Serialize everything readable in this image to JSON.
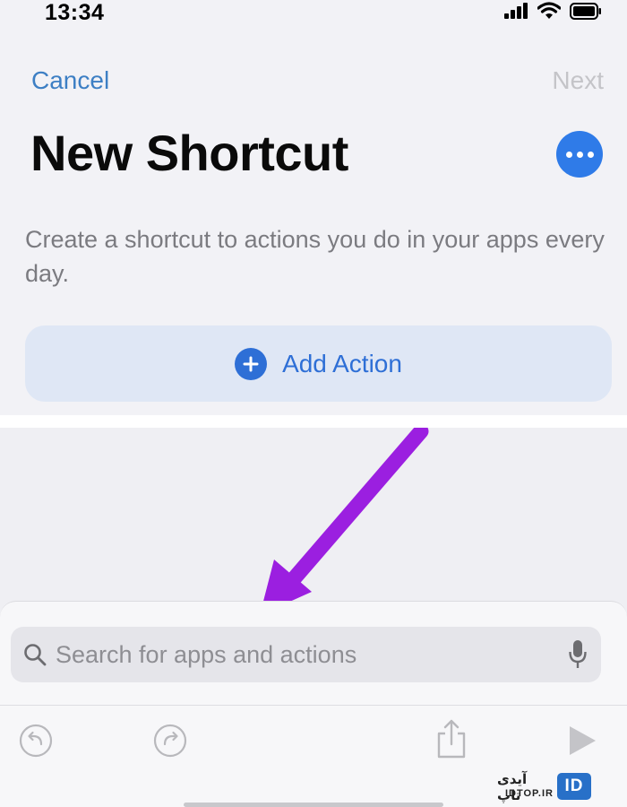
{
  "status_bar": {
    "time": "13:34",
    "icons": [
      "cellular-signal-icon",
      "wifi-icon",
      "battery-icon"
    ]
  },
  "nav": {
    "cancel_label": "Cancel",
    "next_label": "Next"
  },
  "header": {
    "title": "New Shortcut",
    "more_icon": "ellipsis-icon"
  },
  "main": {
    "description": "Create a shortcut to actions you do in your apps every day.",
    "add_action_label": "Add Action",
    "add_action_icon": "plus-circle-icon"
  },
  "search": {
    "placeholder": "Search for apps and actions",
    "value": ""
  },
  "toolbar": {
    "icons": [
      "undo-icon",
      "redo-icon",
      "share-icon",
      "play-icon"
    ]
  },
  "watermark": {
    "persian_text": "آیدی تاپ",
    "latin_text": "IDTOP.IR",
    "logo_text": "ID"
  },
  "colors": {
    "accent": "#3d7fc4",
    "button_blue": "#2f7be8",
    "add_action_bg": "#dfe7f5",
    "arrow": "#9b1fe0"
  }
}
